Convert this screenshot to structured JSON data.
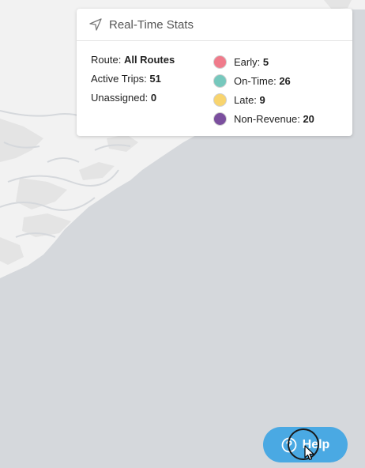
{
  "panel": {
    "title": "Real-Time Stats",
    "route_label": "Route:",
    "route_value": "All Routes",
    "active_label": "Active Trips:",
    "active_value": "51",
    "unassigned_label": "Unassigned:",
    "unassigned_value": "0",
    "legend": [
      {
        "label": "Early:",
        "value": "5",
        "color": "#f07b8b"
      },
      {
        "label": "On-Time:",
        "value": "26",
        "color": "#76c8bd"
      },
      {
        "label": "Late:",
        "value": "9",
        "color": "#f8d46e"
      },
      {
        "label": "Non-Revenue:",
        "value": "20",
        "color": "#7b4f9e"
      }
    ]
  },
  "help": {
    "label": "Help",
    "icon": "question-circle-icon"
  },
  "colors": {
    "water": "#d5d8dc",
    "land": "#f2f2f2",
    "accent": "#4aa9e3"
  }
}
